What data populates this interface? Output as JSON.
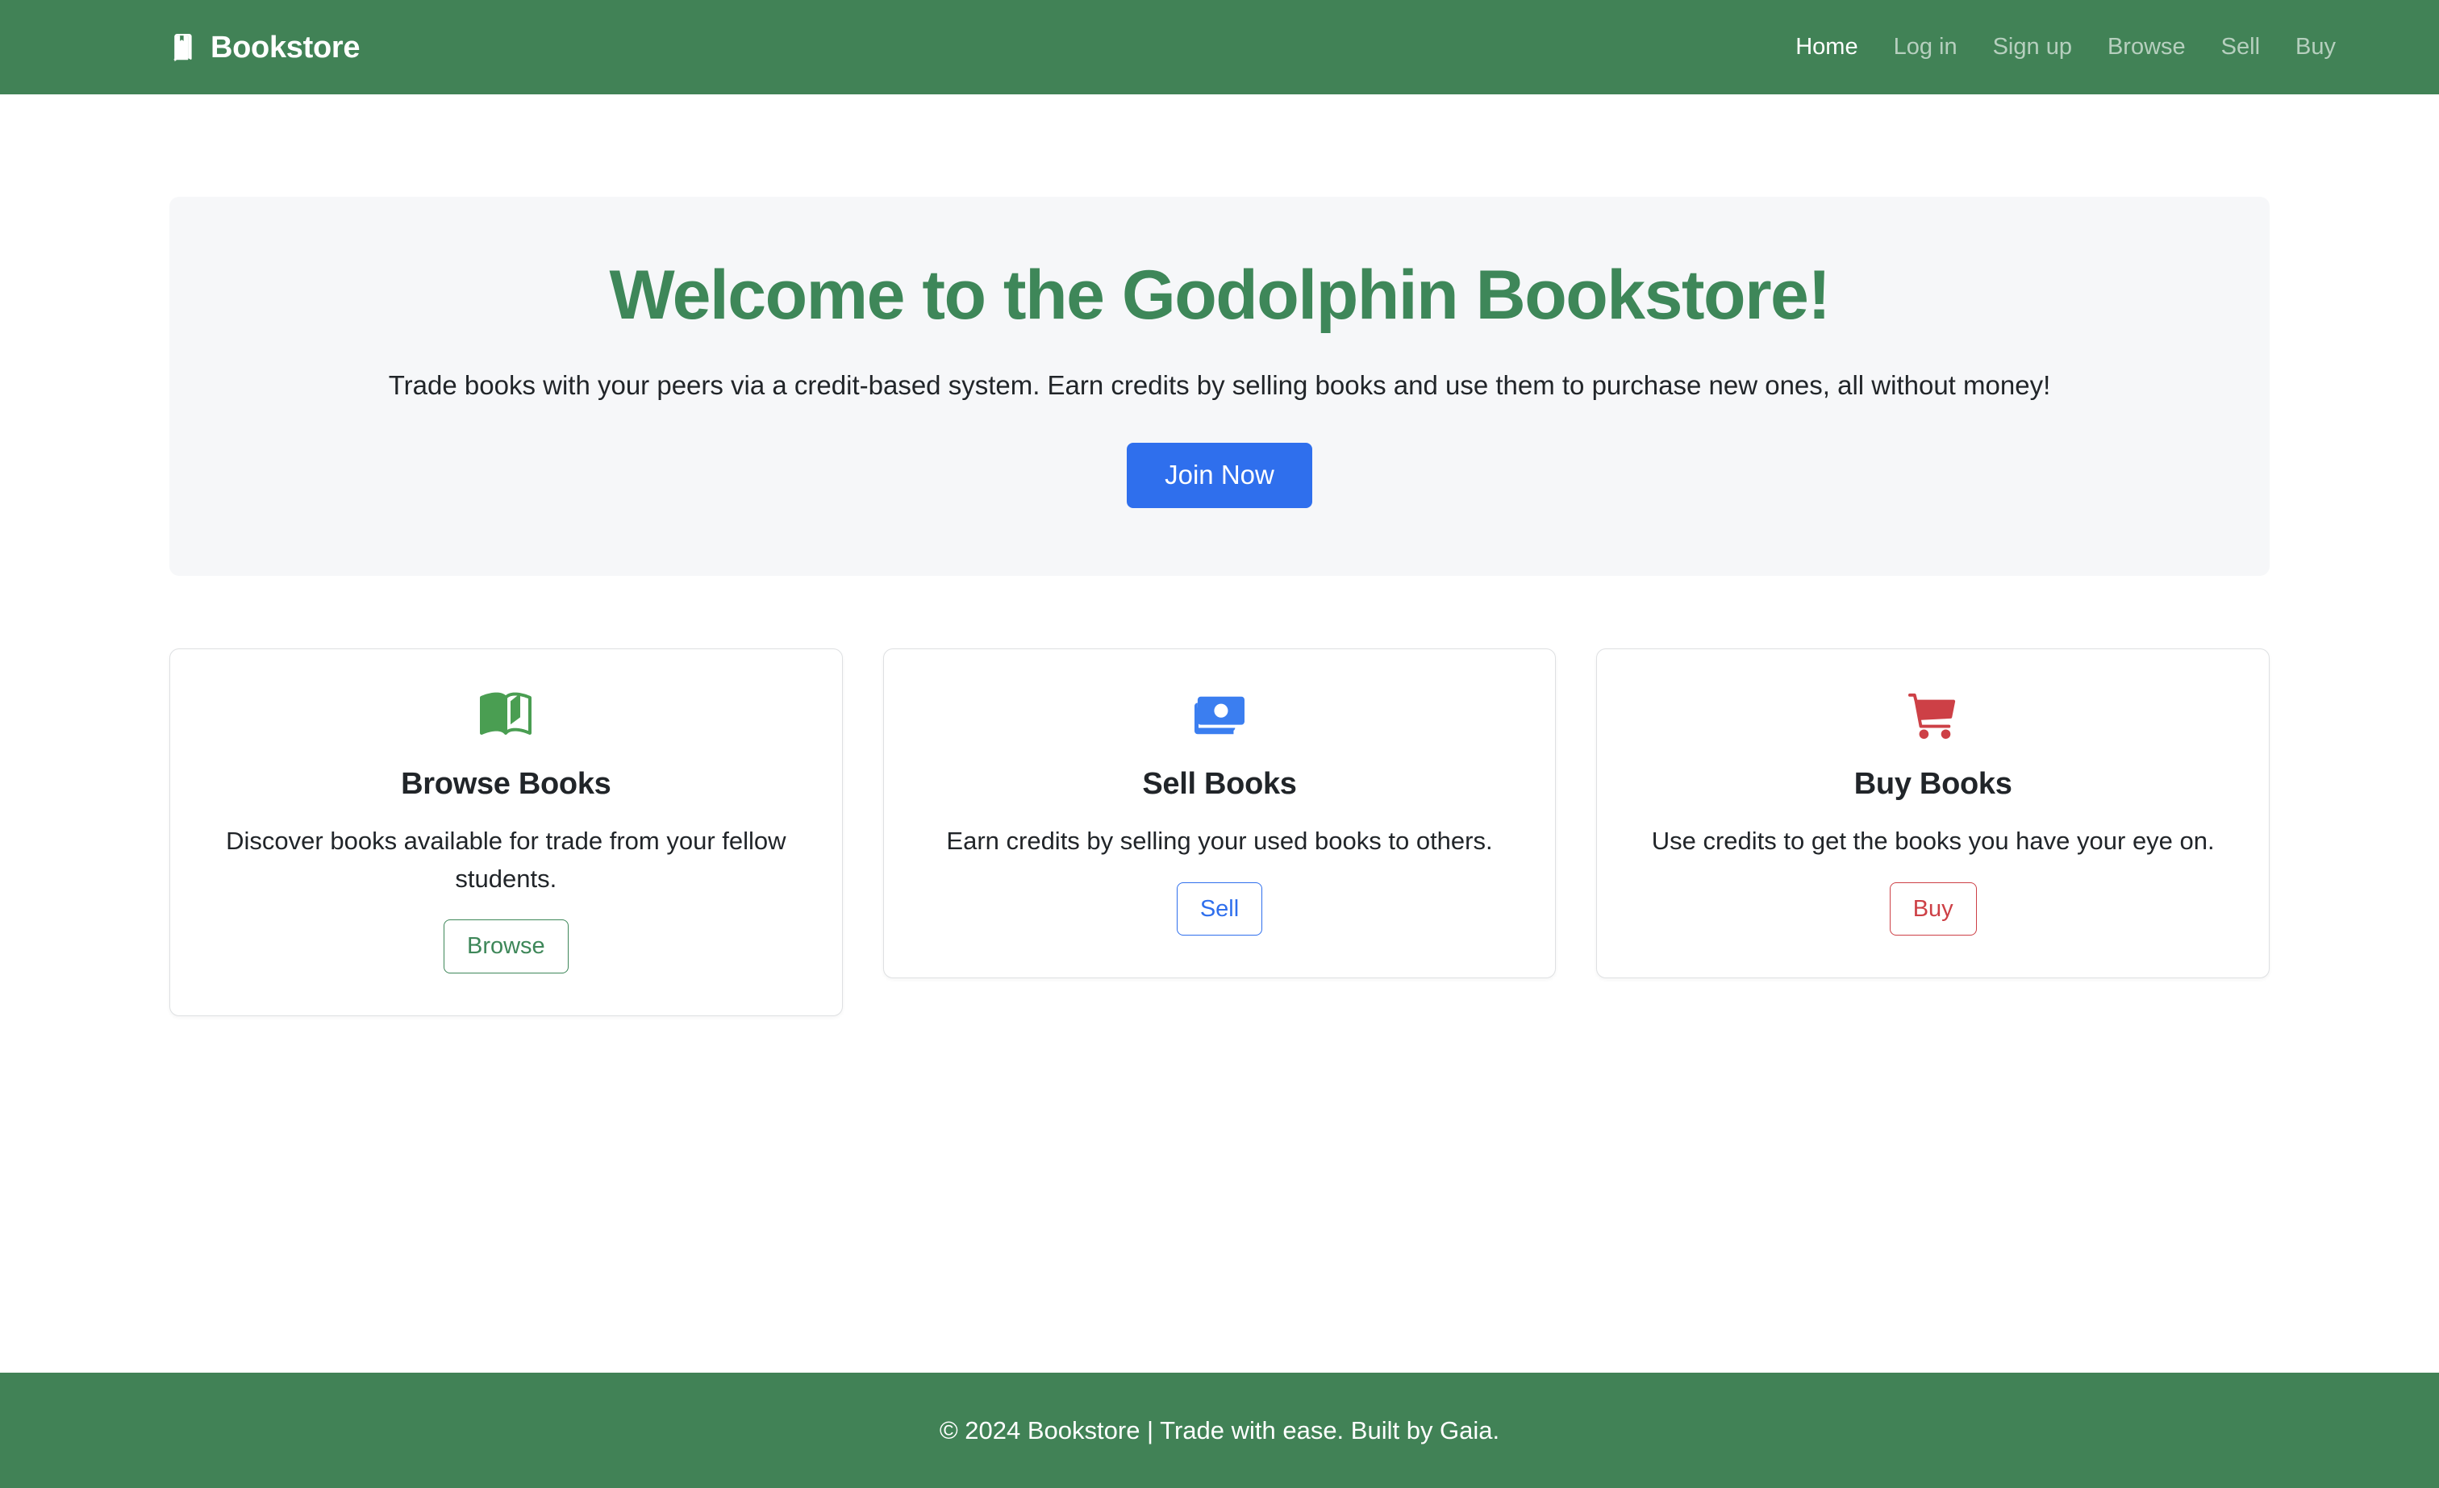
{
  "navbar": {
    "brand": {
      "label": "Bookstore",
      "icon": "book-bookmark-icon"
    },
    "links": [
      {
        "label": "Home",
        "active": true
      },
      {
        "label": "Log in",
        "active": false
      },
      {
        "label": "Sign up",
        "active": false
      },
      {
        "label": "Browse",
        "active": false
      },
      {
        "label": "Sell",
        "active": false
      },
      {
        "label": "Buy",
        "active": false
      }
    ],
    "background_color": "#418256"
  },
  "hero": {
    "title": "Welcome to the Godolphin Bookstore!",
    "subtitle": "Trade books with your peers via a credit-based system. Earn credits by selling books and use them to purchase new ones, all without money!",
    "cta_label": "Join Now",
    "cta_color": "#2f6fed",
    "title_color": "#3e8759",
    "background_color": "#f6f7f9"
  },
  "cards": [
    {
      "icon": "open-book-icon",
      "icon_color": "#4a9e52",
      "title": "Browse Books",
      "text": "Discover books available for trade from your fellow students.",
      "button_label": "Browse",
      "button_color": "#3e8759"
    },
    {
      "icon": "cash-stack-icon",
      "icon_color": "#3b7ef0",
      "title": "Sell Books",
      "text": "Earn credits by selling your used books to others.",
      "button_label": "Sell",
      "button_color": "#2f6fed"
    },
    {
      "icon": "shopping-cart-icon",
      "icon_color": "#cd4046",
      "title": "Buy Books",
      "text": "Use credits to get the books you have your eye on.",
      "button_label": "Buy",
      "button_color": "#cd4046"
    }
  ],
  "footer": {
    "text": "© 2024 Bookstore | Trade with ease. Built by Gaia.",
    "background_color": "#418256"
  }
}
